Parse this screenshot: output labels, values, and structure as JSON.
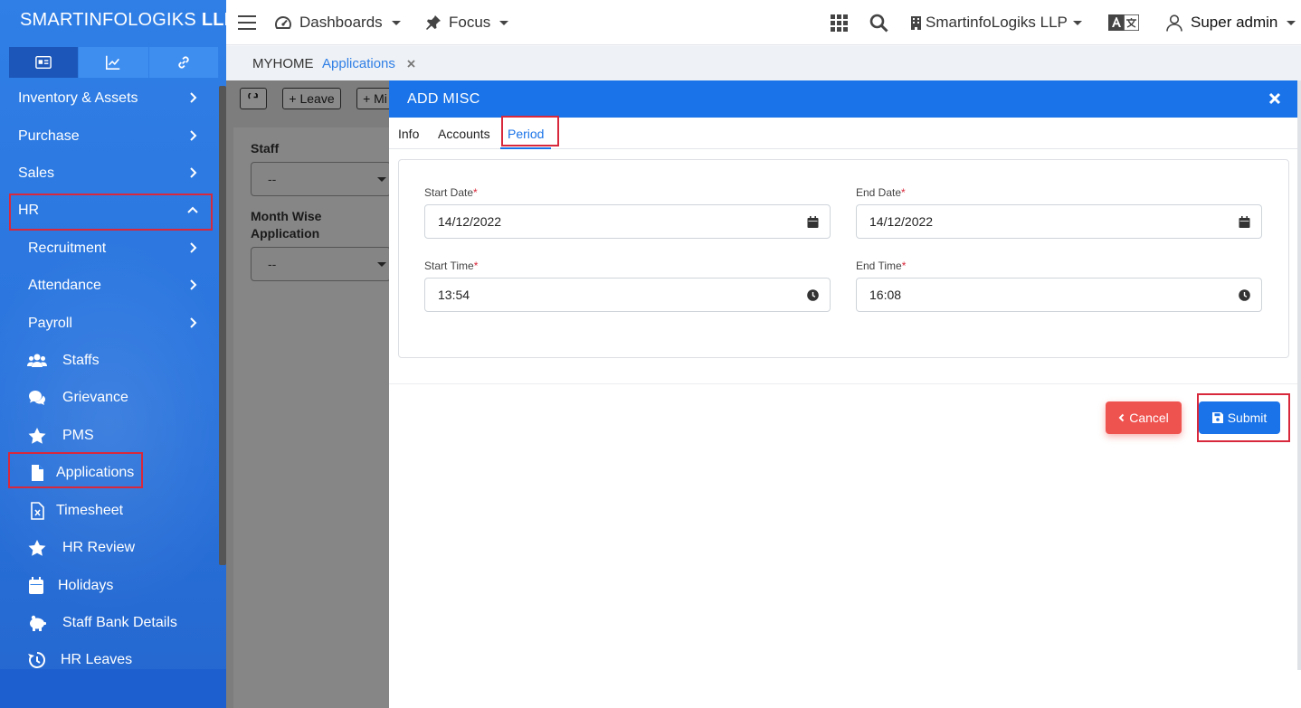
{
  "sidebar": {
    "brand_main": "SMARTINFOLOGIKS",
    "brand_bold": "LLP",
    "tabs": [
      {
        "icon": "id-card-icon"
      },
      {
        "icon": "line-chart-icon"
      },
      {
        "icon": "link-icon"
      }
    ],
    "items": [
      {
        "label": "Inventory & Assets"
      },
      {
        "label": "Purchase"
      },
      {
        "label": "Sales"
      },
      {
        "label": "HR"
      },
      {
        "label": "Recruitment"
      },
      {
        "label": "Attendance"
      },
      {
        "label": "Payroll"
      },
      {
        "label": "Staffs",
        "icon": "users-icon"
      },
      {
        "label": "Grievance",
        "icon": "comments-icon"
      },
      {
        "label": "PMS",
        "icon": "star-icon"
      },
      {
        "label": "Applications",
        "icon": "file-icon"
      },
      {
        "label": "Timesheet",
        "icon": "excel-file-icon"
      },
      {
        "label": "HR Review",
        "icon": "star-icon"
      },
      {
        "label": "Holidays",
        "icon": "calendar-icon"
      },
      {
        "label": "Staff Bank Details",
        "icon": "piggy-bank-icon"
      },
      {
        "label": "HR Leaves",
        "icon": "history-icon"
      }
    ]
  },
  "topbar": {
    "dashboards": "Dashboards",
    "focus": "Focus",
    "company": "SmartinfoLogiks LLP",
    "user": "Super admin"
  },
  "breadcrumb": {
    "home": "MYHOME",
    "current": "Applications"
  },
  "bgpage": {
    "refresh_icon": "refresh-icon",
    "leave_button": "+ Leave",
    "misc_button": "+ Mi",
    "staff_label": "Staff",
    "staff_value": "--",
    "month_label_1": "Month Wise",
    "month_label_2": "Application",
    "month_value": "--"
  },
  "modal": {
    "title": "ADD MISC",
    "tabs": {
      "info": "Info",
      "accounts": "Accounts",
      "period": "Period"
    },
    "fields": {
      "start_date_label": "Start Date",
      "start_date": "14/12/2022",
      "end_date_label": "End Date",
      "end_date": "14/12/2022",
      "start_time_label": "Start Time",
      "start_time": "13:54",
      "end_time_label": "End Time",
      "end_time": "16:08"
    },
    "cancel": "Cancel",
    "submit": "Submit"
  },
  "colors": {
    "primary": "#1a73e8",
    "sidebar": "#2f7fe6",
    "danger": "#ef5350",
    "highlight": "#d8283b"
  }
}
